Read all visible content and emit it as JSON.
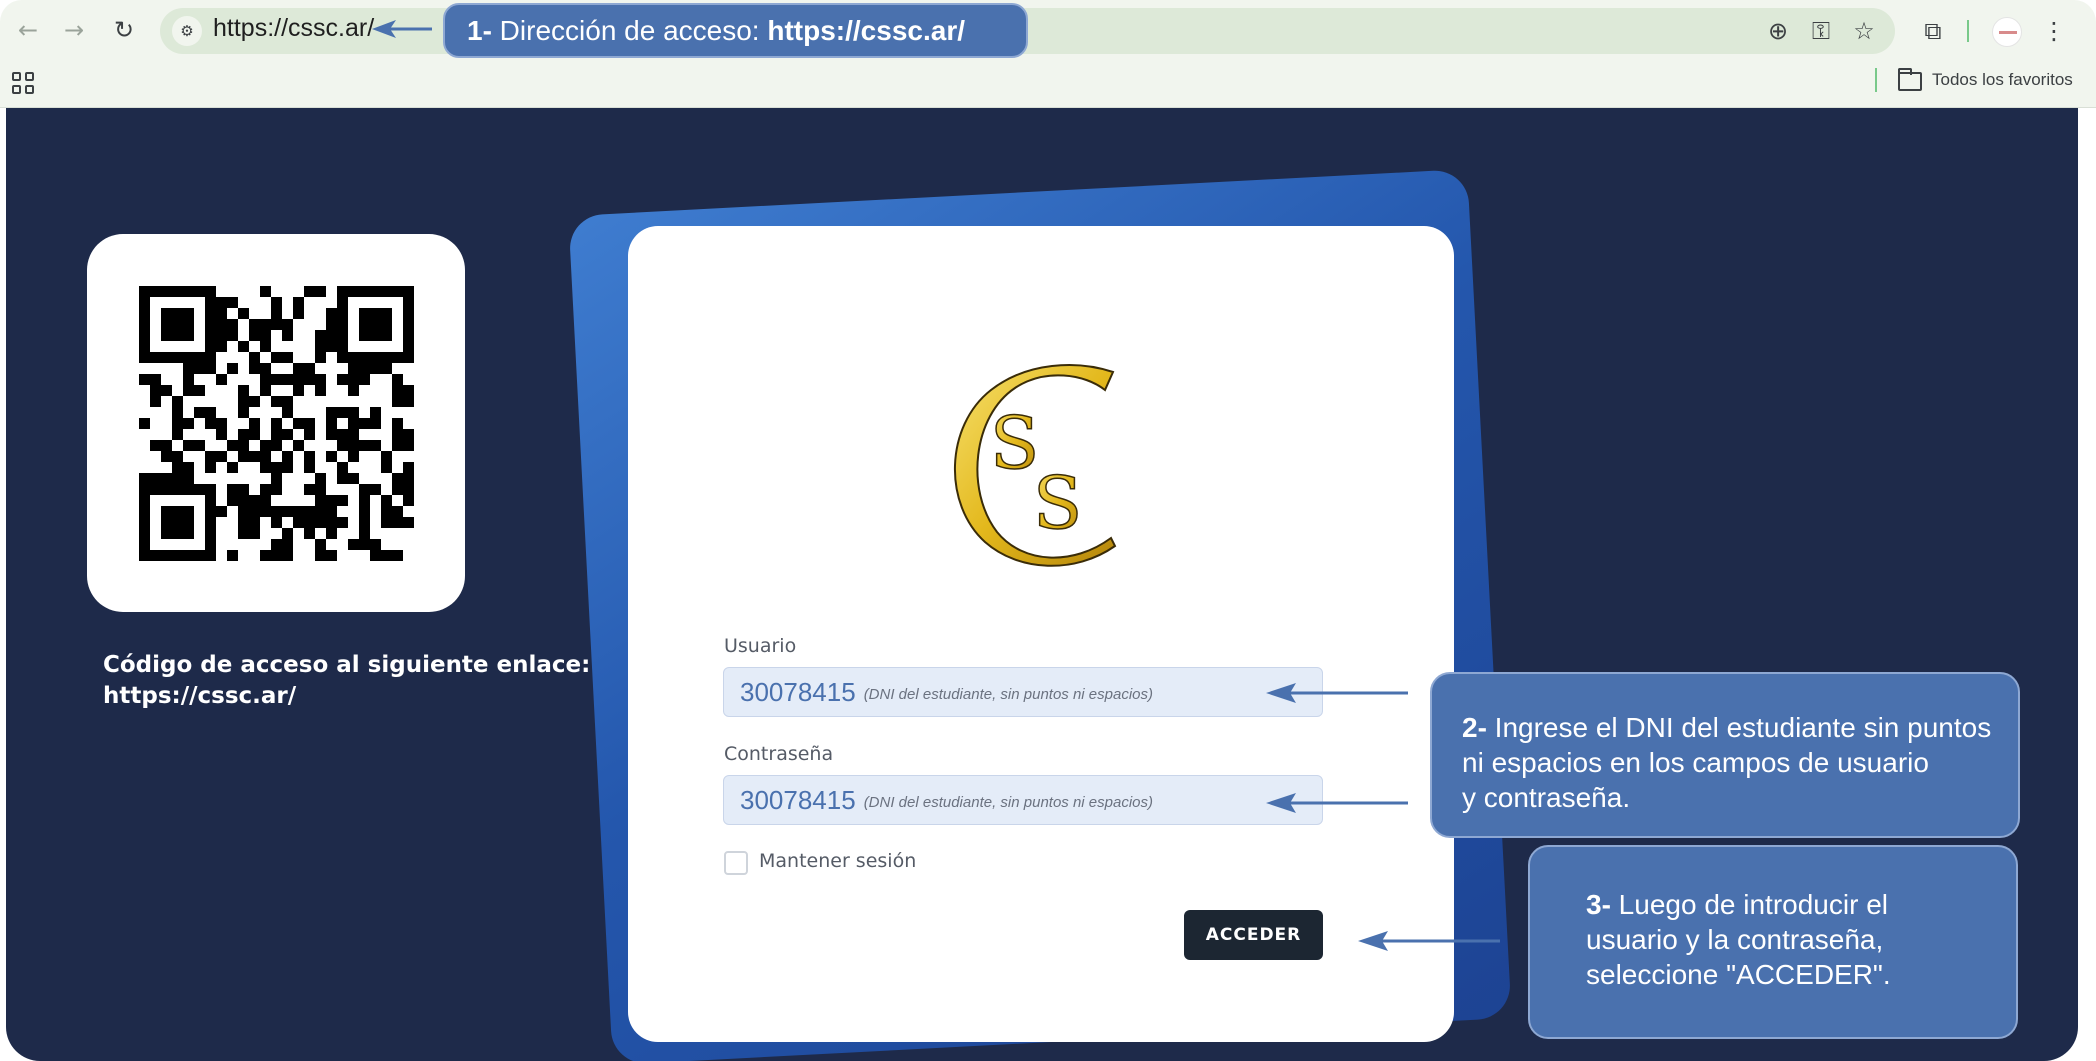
{
  "browser": {
    "url": "https://cssc.ar/",
    "bookmarks_folder": "Todos los favoritos",
    "icons": [
      "back-icon",
      "forward-icon",
      "reload-icon",
      "site-info-icon",
      "zoom-icon",
      "password-key-icon",
      "star-bookmark-icon",
      "extensions-icon",
      "profile-avatar",
      "more-menu-icon",
      "apps-grid-icon",
      "folder-icon"
    ]
  },
  "callouts": {
    "step1": {
      "num": "1-",
      "text": " Dirección de acceso: ",
      "url": "https://cssc.ar/"
    },
    "step2": {
      "num": "2-",
      "line1": " Ingrese el DNI del estudiante sin puntos",
      "line2": "ni espacios en los campos de usuario",
      "line3": "y contraseña."
    },
    "step3": {
      "num": "3-",
      "line1": " Luego de introducir el",
      "line2": "usuario y la contraseña,",
      "line3": "seleccione \"ACCEDER\"."
    }
  },
  "qr": {
    "caption_line1": "Código de acceso al siguiente enlace:",
    "caption_line2": "https://cssc.ar/"
  },
  "login": {
    "logo_letters": "CSS",
    "usuario_label": "Usuario",
    "usuario_value": "30078415",
    "usuario_hint": "(DNI del estudiante, sin puntos ni espacios)",
    "password_label": "Contraseña",
    "password_value": "30078415",
    "password_hint": "(DNI del estudiante, sin puntos ni espacios)",
    "remember_label": "Mantener sesión",
    "remember_checked": false,
    "submit_label": "ACCEDER"
  },
  "colors": {
    "page_background": "#1e2a4a",
    "callout": "#4a71ae",
    "button": "#1c2632",
    "field": "#e4ecf8",
    "logo_gold": "#e3b81c"
  }
}
